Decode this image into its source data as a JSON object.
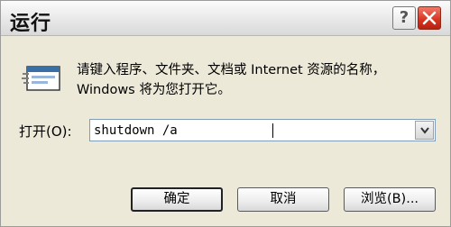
{
  "window": {
    "title": "运行"
  },
  "titlebar": {
    "help_icon": "question-mark-icon",
    "close_icon": "close-x-icon",
    "help_label": "?"
  },
  "dialog": {
    "description": "请键入程序、文件夹、文档或 Internet 资源的名称，Windows 将为您打开它。",
    "run_icon": "run-window-icon",
    "open_label": "打开(O):",
    "command_value": "shutdown /a",
    "dropdown_icon": "chevron-down-icon"
  },
  "buttons": {
    "ok": "确定",
    "cancel": "取消",
    "browse": "浏览(B)..."
  },
  "colors": {
    "dialog_bg": "#ece9d8",
    "close_button": "#d6331f",
    "input_border": "#7f9db9"
  }
}
